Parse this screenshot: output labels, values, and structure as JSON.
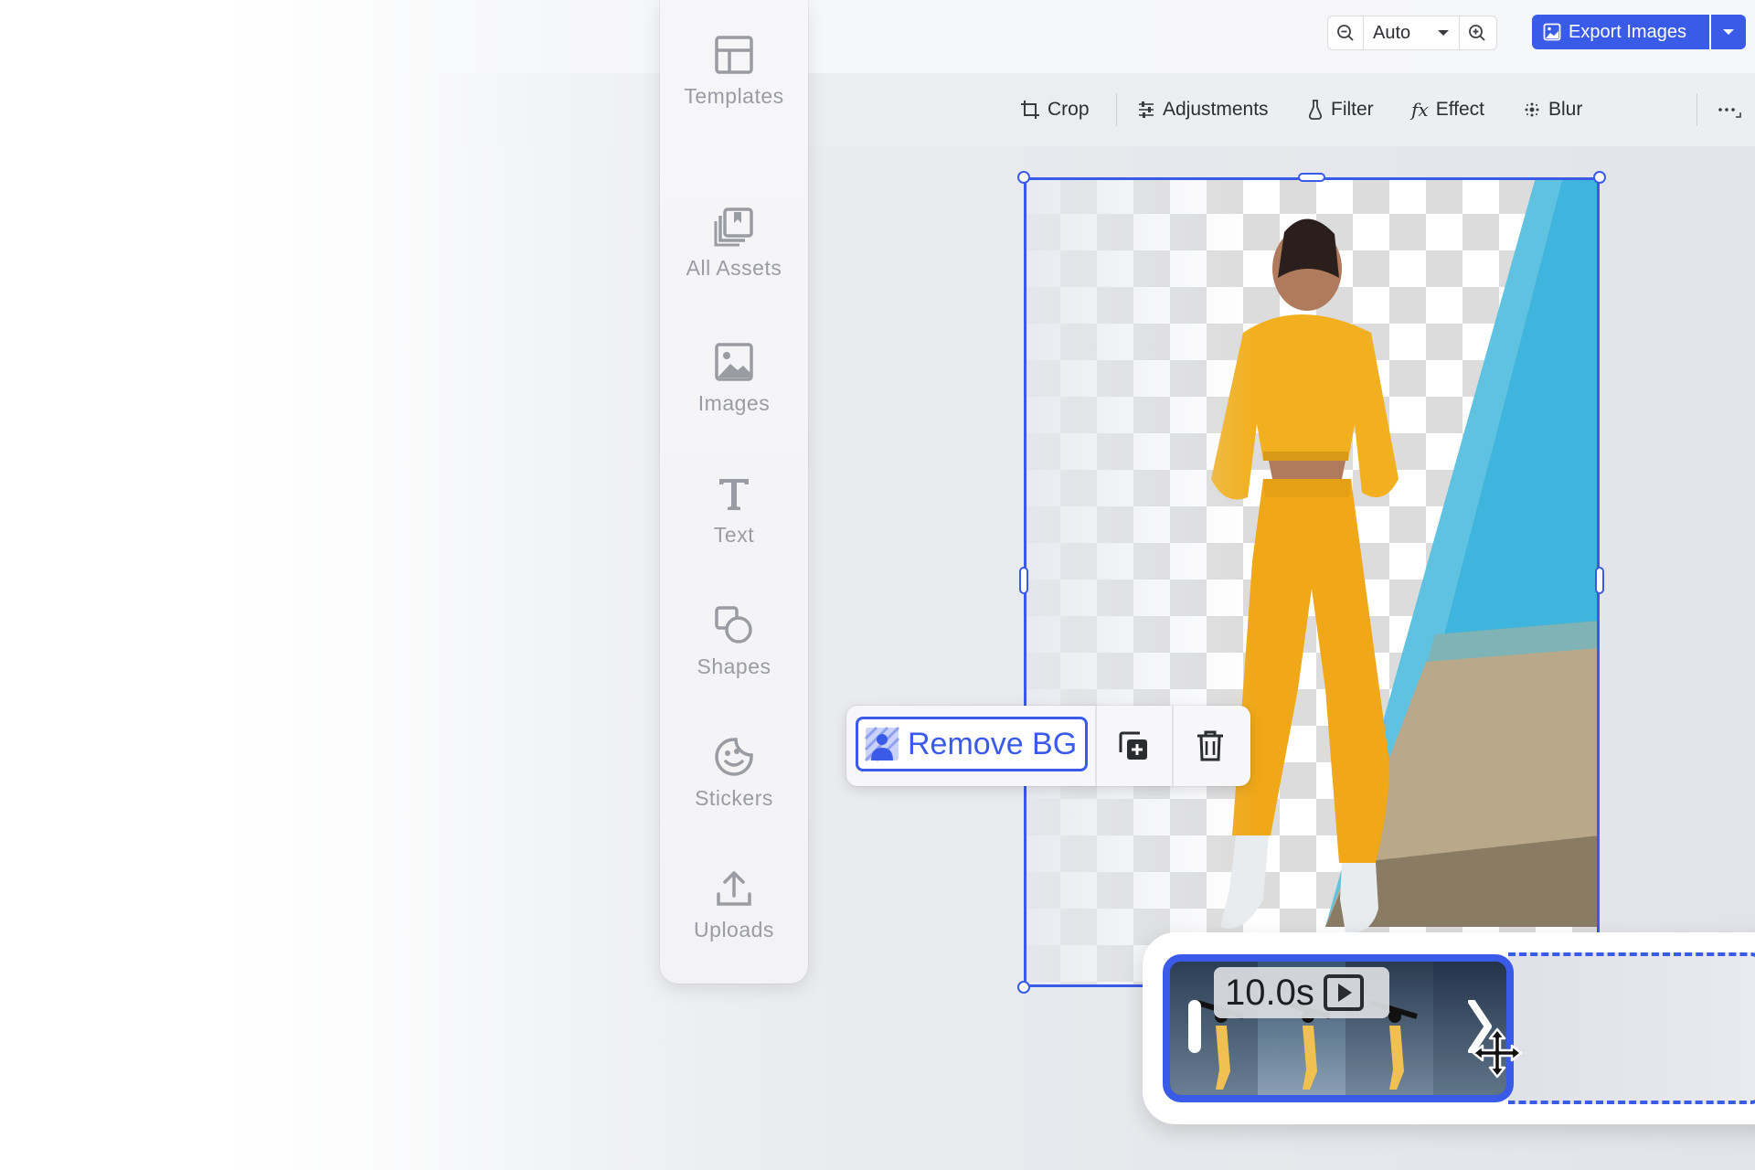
{
  "sidebar": {
    "items": [
      {
        "label": "Templates",
        "icon": "templates-icon"
      },
      {
        "label": "All Assets",
        "icon": "assets-icon"
      },
      {
        "label": "Images",
        "icon": "image-icon"
      },
      {
        "label": "Text",
        "icon": "text-icon"
      },
      {
        "label": "Shapes",
        "icon": "shapes-icon"
      },
      {
        "label": "Stickers",
        "icon": "sticker-icon"
      },
      {
        "label": "Uploads",
        "icon": "upload-icon"
      }
    ]
  },
  "topbar": {
    "zoom_value": "Auto",
    "export_label": "Export Images"
  },
  "toolbar": {
    "crop": "Crop",
    "adjustments": "Adjustments",
    "filter": "Filter",
    "effect": "Effect",
    "blur": "Blur"
  },
  "context_menu": {
    "remove_bg": "Remove BG"
  },
  "timeline": {
    "duration": "10.0s"
  },
  "colors": {
    "accent": "#3a5ae8"
  }
}
